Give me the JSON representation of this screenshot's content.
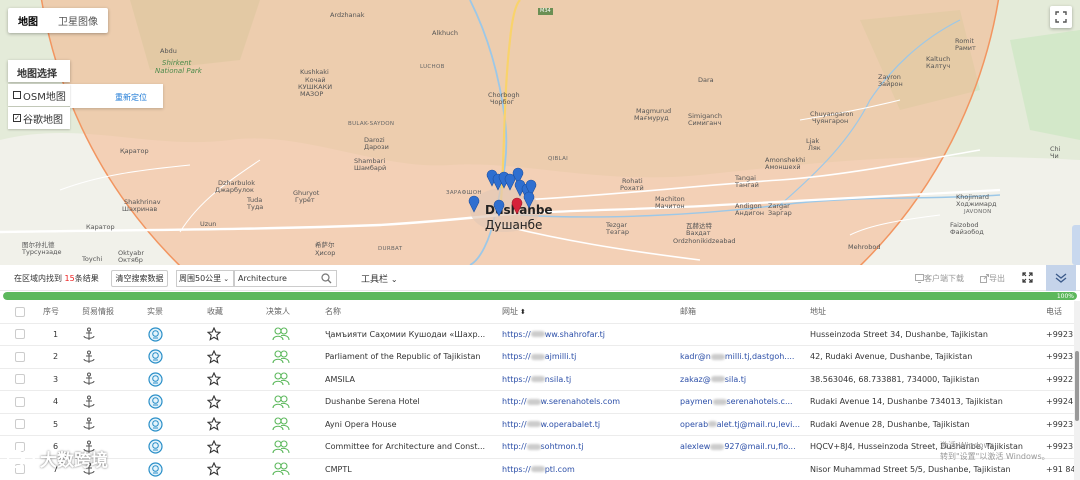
{
  "map": {
    "tabs": [
      {
        "label": "地图"
      },
      {
        "label": "卫星图像"
      }
    ],
    "select_title": "地图选择",
    "relocate": "重新定位",
    "options": [
      {
        "label": "OSM地图",
        "checked": false
      },
      {
        "label": "谷歌地图",
        "checked": true
      }
    ],
    "labels": {
      "ardzhanak": "Ardzhanak",
      "m34": "M34",
      "alkhuch": "Alkhuch",
      "abdu": "Abdu",
      "shirkent": "Shirkent",
      "national_park": "National Park",
      "luchob": "LUCHOB",
      "kushkaki": "Kushkaki",
      "kochai": "Кочай",
      "kushkaki_cyr": "КУШКАКИ",
      "mazor": "МАЗОР",
      "chorbogh": "Chorbogh",
      "chorbag": "Чорбог",
      "bulak_saydon": "BULAK-SAYDON",
      "darozi": "Darozi",
      "darozi_cyr": "Дарози",
      "shambari": "Shambari",
      "shambari_cyr": "Шамбарй",
      "qiblai": "QIBLAI",
      "karator": "Қаратор",
      "dzharbulok": "Dzharbulok",
      "dzharbulok_cyr": "Джарбулок",
      "tuda": "Tuda",
      "tuda_cyr": "Туда",
      "ghuryot": "Ghuryot",
      "ghuryot_cyr": "Гурёт",
      "shakhrinav": "Shakhrinav",
      "shakhrinav_cyr": "Шахринав",
      "uzun": "Uzun",
      "karator2": "Каратор",
      "durbat": "DURBAT",
      "zarafshon": "ЗАРАФШОН",
      "dushanbe": "Dushanbe",
      "dushanbe_cyr": "Душанбе",
      "turkestan": "图尔孙扎德",
      "turkestan_cyr": "Турсунзаде",
      "oktyabr": "Oktyabr",
      "oktyabr_cyr": "Октябр",
      "toychi": "Toychi",
      "hisor": "希萨尔",
      "hisor_cyr": "Ҳисор",
      "rohati": "Rohati",
      "rohati_cyr": "Рохатй",
      "machiton": "Machiton",
      "machiton_cyr": "Мачитон",
      "tezgar": "Tezgar",
      "tezgar_cyr": "Тезгар",
      "ordzhonikidzeabad": "Ordzhonikidzeabad",
      "vahdat": "瓦赫达特",
      "vahdat_cyr": "Вахдат",
      "dara": "Dara",
      "magmurud": "Magmurud",
      "magmurud_cyr": "Мағмуруд",
      "simiganch": "Simiganch",
      "simiganch_cyr": "Симиганч",
      "chuyangaron": "Chuyangaron",
      "chuyangaron_cyr": "Чуянгарон",
      "lyakk": "Ljak",
      "lyakk_cyr": "Ляк",
      "amonshekhi": "Amonshekhi",
      "amonshekhi_cyr": "Амоншехй",
      "tangai": "Tangai",
      "tangai_cyr": "Тангай",
      "andigon": "Andigon",
      "andigon_cyr": "Андигон",
      "zargar": "Zargar",
      "zargar_cyr": "Заргар",
      "mehrobod": "Mehrobod",
      "romit": "Romit",
      "ramit": "Рамит",
      "kaltuch": "Kaltuch",
      "kaltuch_cyr": "Калтуч",
      "zayron": "Zayron",
      "zayron_cyr": "Зайрон",
      "khojimard": "Khojimard",
      "khojimard_cyr": "Ходжимард",
      "javonon": "JAVONON",
      "faizobod": "Faizobod",
      "faizobod_cyr": "Файзобод",
      "chi": "Chi",
      "chi_cyr": "Чи"
    }
  },
  "toolbar": {
    "found_prefix": "在区域内找到",
    "found_count": "15",
    "found_suffix": "条结果",
    "clear_button": "清空搜索数据",
    "range_select": "周围50公里",
    "keyword": "Architecture",
    "tools_label": "工具栏",
    "client_download": "客户端下载",
    "export": "导出"
  },
  "progress": {
    "value": 100,
    "label": "100%"
  },
  "table": {
    "headers": {
      "index": "序号",
      "trade": "贸易情报",
      "verify": "实景",
      "fav": "收藏",
      "decision": "决策人",
      "name": "名称",
      "website": "网址",
      "email": "邮箱",
      "address": "地址",
      "phone": "电话"
    },
    "rows": [
      {
        "index": "1",
        "name": "Ҷамъияти Саҳомии Кушодаи «Шахр...",
        "site_a": "https://",
        "site_b": "ww.shahrofar.tj",
        "email_a": "",
        "email_b": "",
        "address": "Husseinzoda Street 34, Dushanbe, Tajikistan",
        "phone": "+9923"
      },
      {
        "index": "2",
        "name": "Parliament of the Republic of Tajikistan",
        "site_a": "https://",
        "site_b": "ajmilli.tj",
        "email_a": "kadr@n",
        "email_b": "milli.tj,dastgoh....",
        "address": "42, Rudaki Avenue, Dushanbe, Tajikistan",
        "phone": "+9923"
      },
      {
        "index": "3",
        "name": "AMSILA",
        "site_a": "https://",
        "site_b": "nsila.tj",
        "email_a": "zakaz@",
        "email_b": "sila.tj",
        "address": "38.563046, 68.733881, 734000, Tajikistan",
        "phone": "+9922"
      },
      {
        "index": "4",
        "name": "Dushanbe Serena Hotel",
        "site_a": "http://",
        "site_b": "w.serenahotels.com",
        "email_a": "paymen",
        "email_b": "serenahotels.c...",
        "address": "Rudaki Avenue 14, Dushanbe 734013, Tajikistan",
        "phone": "+9924"
      },
      {
        "index": "5",
        "name": "Ayni Opera House",
        "site_a": "http://",
        "site_b": "w.operabalet.tj",
        "email_a": "operab",
        "email_b": "alet.tj@mail.ru,levi...",
        "address": "Rudaki Avenue 28, Dushanbe, Tajikistan",
        "phone": "+9923"
      },
      {
        "index": "6",
        "name": "Committee for Architecture and Const...",
        "site_a": "http://",
        "site_b": "sohtmon.tj",
        "email_a": "alexlew",
        "email_b": "927@mail.ru,flo...",
        "address": "HQCV+8J4, Husseinzoda Street, Dushanbe, Tajikistan",
        "phone": "+9923"
      },
      {
        "index": "7",
        "name": "CMPTL",
        "site_a": "https://",
        "site_b": "ptl.com",
        "email_a": "",
        "email_b": "",
        "address": "Nisor Muhammad Street 5/5, Dushanbe, Tajikistan",
        "phone": "+91 84"
      }
    ]
  },
  "watermark": {
    "line1": "激活 Windows",
    "line2": "转到\"设置\"以激活 Windows。"
  },
  "brand": {
    "name": "大数跨境"
  },
  "colors": {
    "accent": "#1e7ad6",
    "progress": "#5cb85c",
    "marker": "#2f6fd0",
    "marker_red": "#d6233a",
    "region": "#f4b48a"
  }
}
